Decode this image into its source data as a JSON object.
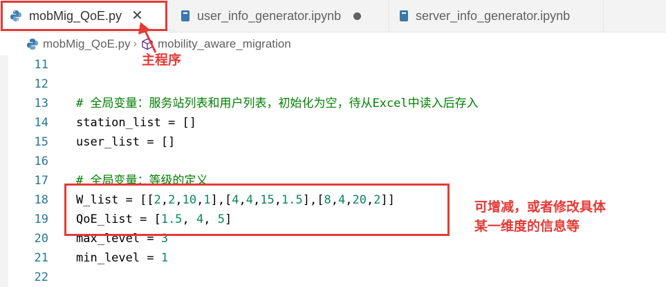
{
  "tabs": [
    {
      "label": "mobMig_QoE.py",
      "icon": "python-file-icon",
      "active": true,
      "close": "✕"
    },
    {
      "label": "user_info_generator.ipynb",
      "icon": "notebook-file-icon",
      "active": false,
      "unsaved": true
    },
    {
      "label": "server_info_generator.ipynb",
      "icon": "notebook-file-icon",
      "active": false
    }
  ],
  "breadcrumb": {
    "file": "mobMig_QoE.py",
    "separator": "›",
    "symbol": "mobility_aware_migration"
  },
  "code": {
    "lines": [
      {
        "n": "11",
        "text": ""
      },
      {
        "n": "12",
        "text": ""
      },
      {
        "n": "13",
        "comment": "# 全局变量：服务站列表和用户列表，初始化为空，待从Excel中读入后存入"
      },
      {
        "n": "14",
        "text": "station_list = []"
      },
      {
        "n": "15",
        "text": "user_list = []"
      },
      {
        "n": "16",
        "text": ""
      },
      {
        "n": "17",
        "comment": "# 全局变量：等级的定义"
      },
      {
        "n": "18",
        "w_prefix": "W_list = [[",
        "w_vals": [
          "2",
          "2",
          "10",
          "1",
          "4",
          "4",
          "15",
          "1.5",
          "8",
          "4",
          "20",
          "2"
        ]
      },
      {
        "n": "19",
        "q_prefix": "QoE_list = [",
        "q_vals": [
          "1.5",
          "4",
          "5"
        ]
      },
      {
        "n": "20",
        "t_prefix": "max_level = ",
        "t_val": "3"
      },
      {
        "n": "21",
        "t_prefix": "min_level = ",
        "t_val": "1"
      },
      {
        "n": "22",
        "text": ""
      }
    ]
  },
  "annotations": {
    "main_program": "主程序",
    "editable_line1": "可增减，或者修改具体",
    "editable_line2": "某一维度的信息等"
  },
  "colors": {
    "accent_red": "#e53935",
    "comment_green": "#008000",
    "number_green": "#098658",
    "line_number": "#237893"
  }
}
